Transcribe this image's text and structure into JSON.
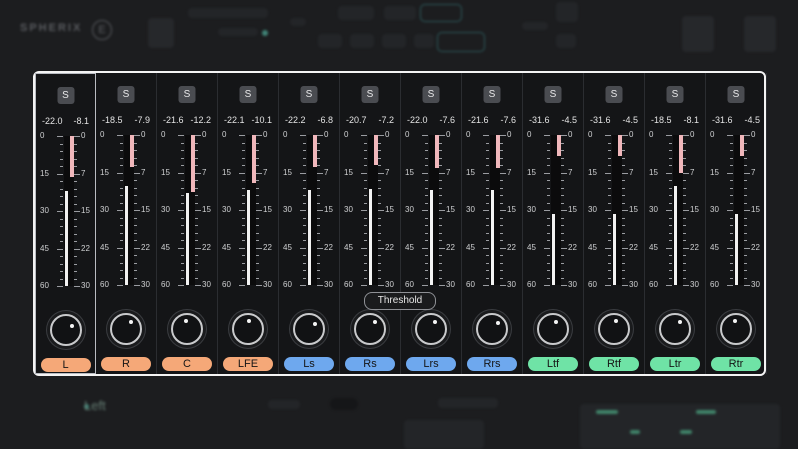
{
  "brand": {
    "name": "SPHERIX",
    "badge": "E"
  },
  "bottom": {
    "section_left": "Left"
  },
  "threshold_label": "Threshold",
  "solo_label": "S",
  "scale_ticks": [
    "0",
    "15",
    "30",
    "45",
    "60"
  ],
  "ratio_ticks": [
    "0",
    "7",
    "15",
    "22",
    "30"
  ],
  "channels": [
    {
      "name": "L",
      "group": "front",
      "peak": "-22.0",
      "gr": "-8.1",
      "level": 0.63,
      "reduction": 0.27,
      "selected": true
    },
    {
      "name": "R",
      "group": "front",
      "peak": "-18.5",
      "gr": "-7.9",
      "level": 0.66,
      "reduction": 0.21,
      "selected": false
    },
    {
      "name": "C",
      "group": "front",
      "peak": "-21.6",
      "gr": "-12.2",
      "level": 0.61,
      "reduction": 0.38,
      "selected": false
    },
    {
      "name": "LFE",
      "group": "front",
      "peak": "-22.1",
      "gr": "-10.1",
      "level": 0.63,
      "reduction": 0.32,
      "selected": false
    },
    {
      "name": "Ls",
      "group": "surround",
      "peak": "-22.2",
      "gr": "-6.8",
      "level": 0.63,
      "reduction": 0.21,
      "selected": false
    },
    {
      "name": "Rs",
      "group": "surround",
      "peak": "-20.7",
      "gr": "-7.2",
      "level": 0.64,
      "reduction": 0.2,
      "selected": false
    },
    {
      "name": "Lrs",
      "group": "surround",
      "peak": "-22.0",
      "gr": "-7.6",
      "level": 0.63,
      "reduction": 0.22,
      "selected": false
    },
    {
      "name": "Rrs",
      "group": "surround",
      "peak": "-21.6",
      "gr": "-7.6",
      "level": 0.63,
      "reduction": 0.22,
      "selected": false
    },
    {
      "name": "Ltf",
      "group": "height",
      "peak": "-31.6",
      "gr": "-4.5",
      "level": 0.47,
      "reduction": 0.14,
      "selected": false
    },
    {
      "name": "Rtf",
      "group": "height",
      "peak": "-31.6",
      "gr": "-4.5",
      "level": 0.47,
      "reduction": 0.14,
      "selected": false
    },
    {
      "name": "Ltr",
      "group": "height",
      "peak": "-18.5",
      "gr": "-8.1",
      "level": 0.66,
      "reduction": 0.25,
      "selected": false
    },
    {
      "name": "Rtr",
      "group": "height",
      "peak": "-31.6",
      "gr": "-4.5",
      "level": 0.47,
      "reduction": 0.14,
      "selected": false
    }
  ],
  "knob_angles": [
    -30,
    -55,
    -95,
    -80,
    -40,
    -55,
    -60,
    -45,
    -65,
    -75,
    -55,
    -95
  ],
  "group_colors": {
    "front": "#f5a878",
    "surround": "#6ea8ee",
    "height": "#6fe3a6"
  }
}
